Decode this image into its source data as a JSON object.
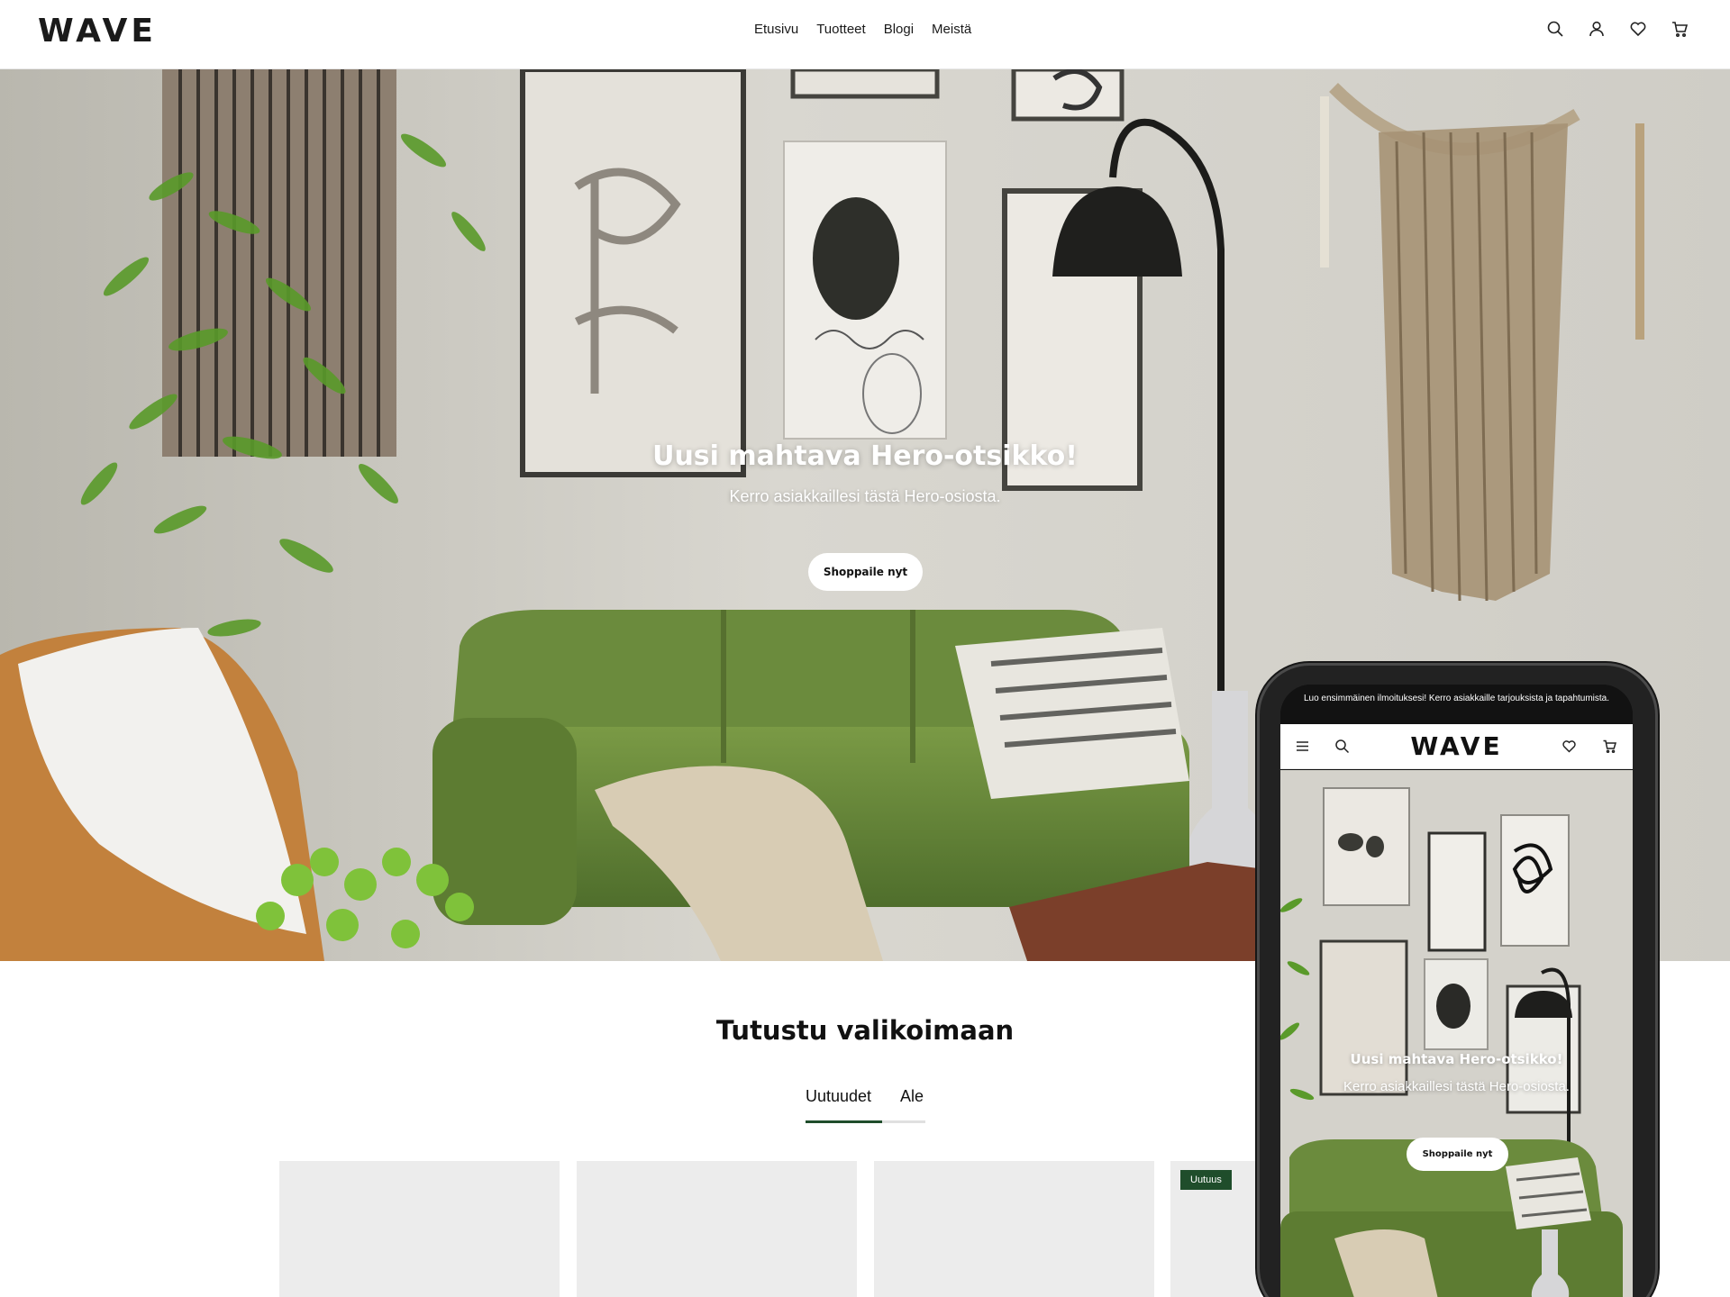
{
  "brand": {
    "logo": "WAVE"
  },
  "nav": {
    "items": [
      "Etusivu",
      "Tuotteet",
      "Blogi",
      "Meistä"
    ]
  },
  "header_icons": [
    "search-icon",
    "account-icon",
    "heart-icon",
    "cart-icon"
  ],
  "hero": {
    "title": "Uusi mahtava Hero-otsikko!",
    "subtitle": "Kerro asiakkaillesi tästä Hero-osiosta.",
    "button": "Shoppaile nyt"
  },
  "collection": {
    "title": "Tutustu valikoimaan",
    "tabs": [
      "Uutuudet",
      "Ale"
    ],
    "active_tab": "Uutuudet",
    "badge": "Uutuus"
  },
  "mobile": {
    "announcement": "Luo ensimmäinen ilmoituksesi! Kerro asiakkaille tarjouksista ja tapahtumista.",
    "logo": "WAVE",
    "hero_title": "Uusi mahtava Hero-otsikko!",
    "hero_subtitle": "Kerro asiakkaillesi tästä Hero-osiosta.",
    "hero_button": "Shoppaile nyt",
    "icons": [
      "menu-icon",
      "search-icon",
      "heart-icon",
      "cart-icon"
    ]
  },
  "colors": {
    "accent": "#1f4d2b",
    "sofa_green": "#6f8f3f",
    "wall": "#d8d6cf"
  }
}
